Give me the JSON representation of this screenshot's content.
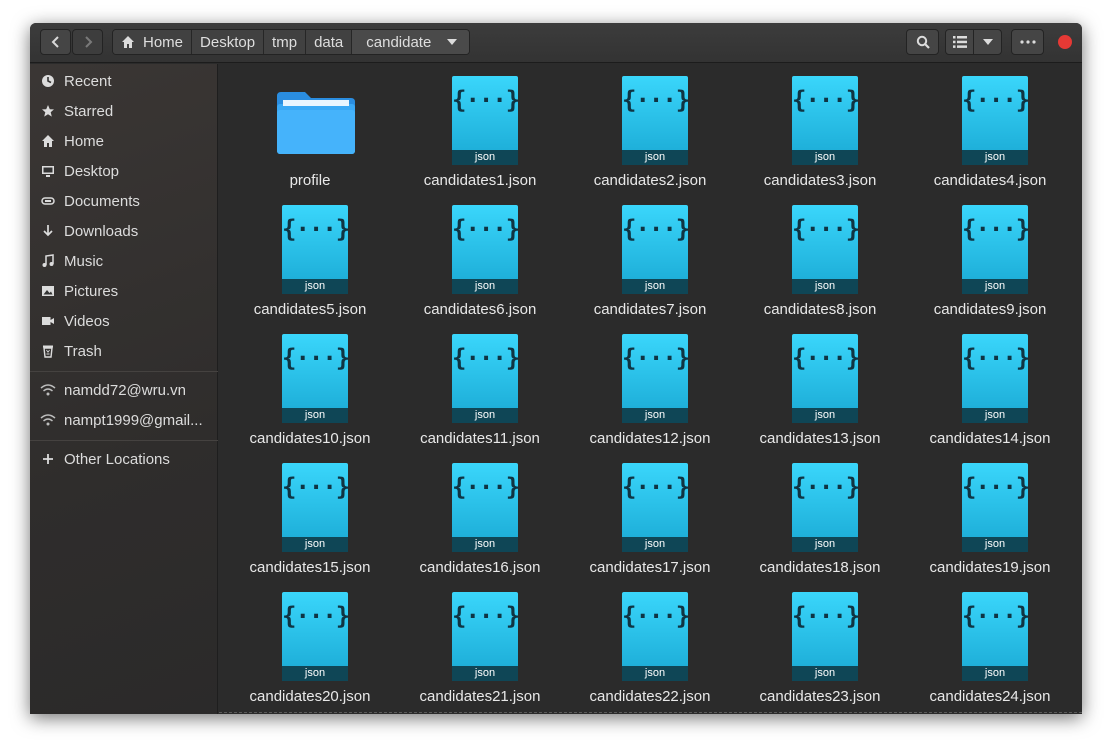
{
  "breadcrumb": {
    "items": [
      "Home",
      "Desktop",
      "tmp",
      "data",
      "candidate"
    ],
    "home_icon": "home-icon",
    "dropdown_icon": "chevron-down-icon"
  },
  "toolbar": {
    "back_icon": "chevron-left-icon",
    "forward_icon": "chevron-right-icon",
    "search_icon": "search-icon",
    "view_icon": "list-view-icon",
    "view_menu_icon": "chevron-down-icon",
    "menu_icon": "more-horizontal-icon",
    "close_icon": "close-icon",
    "close_color": "#e53935"
  },
  "sidebar": {
    "items": [
      {
        "label": "Recent",
        "icon": "clock-icon"
      },
      {
        "label": "Starred",
        "icon": "star-icon"
      },
      {
        "label": "Home",
        "icon": "home-icon"
      },
      {
        "label": "Desktop",
        "icon": "monitor-icon"
      },
      {
        "label": "Documents",
        "icon": "documents-icon"
      },
      {
        "label": "Downloads",
        "icon": "download-icon"
      },
      {
        "label": "Music",
        "icon": "music-icon"
      },
      {
        "label": "Pictures",
        "icon": "picture-icon"
      },
      {
        "label": "Videos",
        "icon": "video-icon"
      },
      {
        "label": "Trash",
        "icon": "trash-icon"
      }
    ],
    "network": [
      {
        "label": "namdd72@wru.vn",
        "icon": "wifi-icon"
      },
      {
        "label": "nampt1999@gmail...",
        "icon": "wifi-icon"
      }
    ],
    "other": {
      "label": "Other Locations",
      "icon": "plus-icon"
    }
  },
  "files": {
    "folder": {
      "name": "profile",
      "icon": "folder-icon",
      "color": "#3aa8f5"
    },
    "json_badge": "json",
    "json_icon": "json-file-icon",
    "json_color": "#2bc4ef",
    "items": [
      "candidates1.json",
      "candidates2.json",
      "candidates3.json",
      "candidates4.json",
      "candidates5.json",
      "candidates6.json",
      "candidates7.json",
      "candidates8.json",
      "candidates9.json",
      "candidates10.json",
      "candidates11.json",
      "candidates12.json",
      "candidates13.json",
      "candidates14.json",
      "candidates15.json",
      "candidates16.json",
      "candidates17.json",
      "candidates18.json",
      "candidates19.json",
      "candidates20.json",
      "candidates21.json",
      "candidates22.json",
      "candidates23.json",
      "candidates24.json"
    ]
  }
}
